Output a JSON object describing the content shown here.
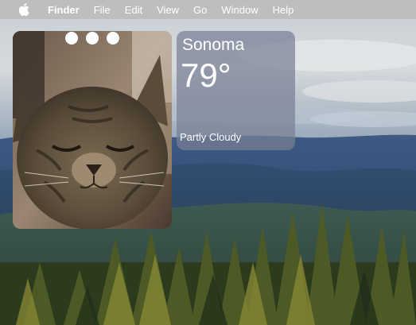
{
  "menubar": {
    "apple_icon": "apple-icon",
    "items": [
      "Finder",
      "File",
      "Edit",
      "View",
      "Go",
      "Window",
      "Help"
    ]
  },
  "photo_widget": {
    "subject": "cat-photo",
    "window_controls": [
      "close",
      "minimize",
      "zoom"
    ]
  },
  "weather": {
    "city": "Sonoma",
    "temperature": "79°",
    "condition": "Partly Cloudy"
  },
  "wallpaper": {
    "scene": "forest-mountain-landscape"
  }
}
